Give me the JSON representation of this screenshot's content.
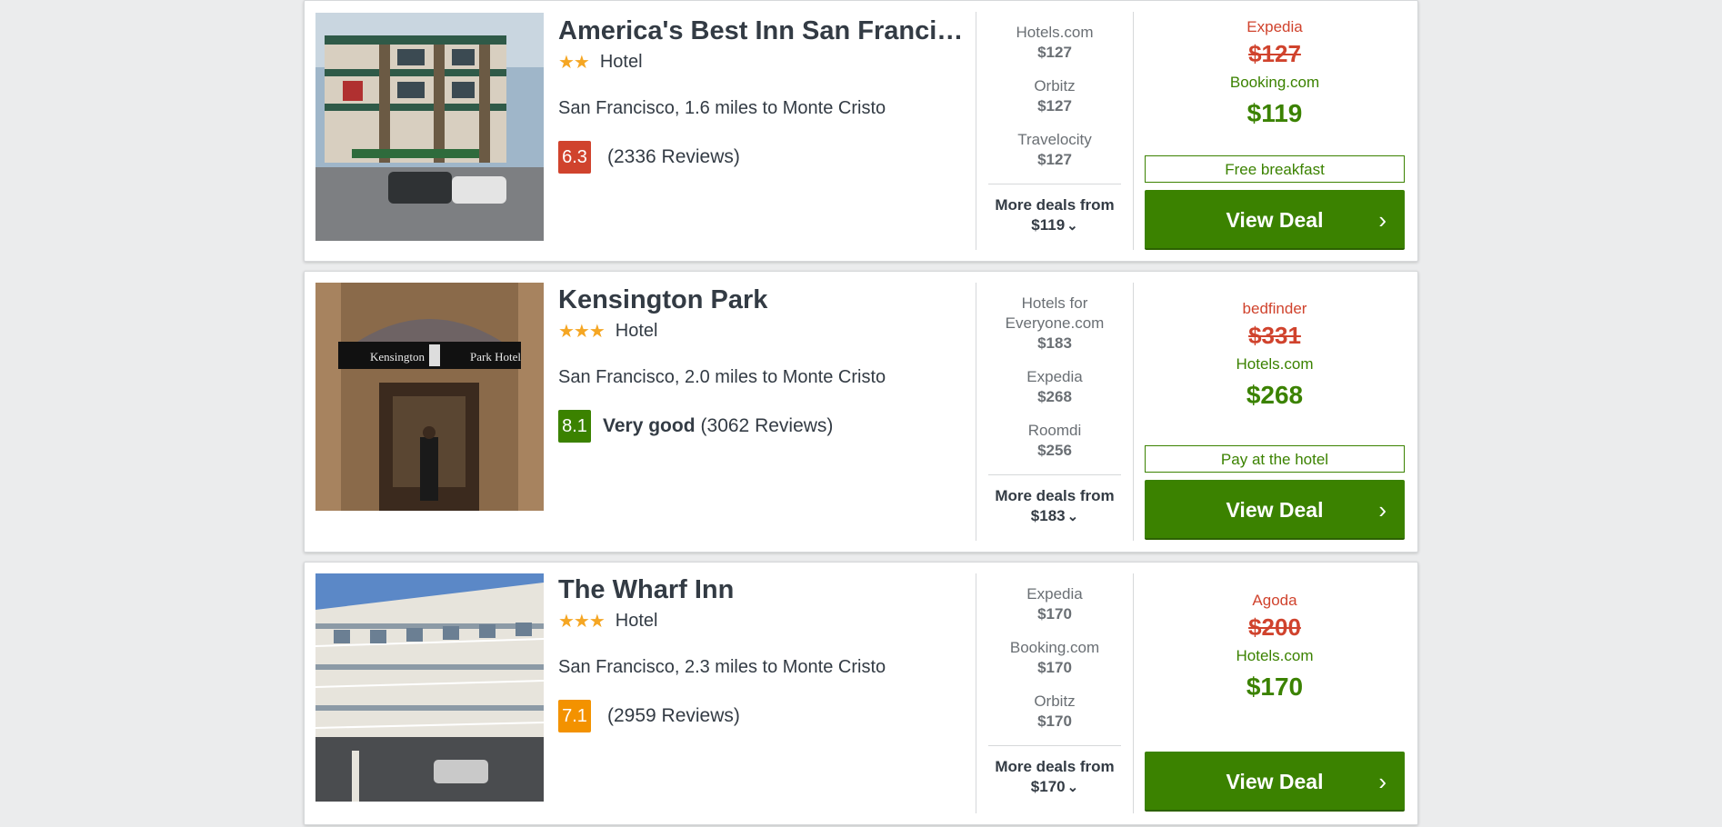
{
  "hotels": [
    {
      "name": "America's Best Inn San Francisco",
      "stars": "★★",
      "type": "Hotel",
      "location": "San Francisco, 1.6 miles to Monte Cristo",
      "score": "6.3",
      "score_color": "#d0432d",
      "rating_label": "",
      "reviews": "(2336 Reviews)",
      "deals": [
        {
          "provider": "Hotels.com",
          "price": "$127"
        },
        {
          "provider": "Orbitz",
          "price": "$127"
        },
        {
          "provider": "Travelocity",
          "price": "$127"
        }
      ],
      "more_label": "More deals from",
      "more_price": "$119",
      "old_provider": "Expedia",
      "old_price": "$127",
      "new_provider": "Booking.com",
      "new_price": "$119",
      "perk": "Free breakfast",
      "button": "View Deal"
    },
    {
      "name": "Kensington Park",
      "stars": "★★★",
      "type": "Hotel",
      "location": "San Francisco, 2.0 miles to Monte Cristo",
      "score": "8.1",
      "score_color": "#3b8200",
      "rating_label": "Very good",
      "reviews": "(3062 Reviews)",
      "deals": [
        {
          "provider": "Hotels for Everyone.com",
          "price": "$183"
        },
        {
          "provider": "Expedia",
          "price": "$268"
        },
        {
          "provider": "Roomdi",
          "price": "$256"
        }
      ],
      "more_label": "More deals from",
      "more_price": "$183",
      "old_provider": "bedfinder",
      "old_price": "$331",
      "new_provider": "Hotels.com",
      "new_price": "$268",
      "perk": "Pay at the hotel",
      "button": "View Deal"
    },
    {
      "name": "The Wharf Inn",
      "stars": "★★★",
      "type": "Hotel",
      "location": "San Francisco, 2.3 miles to Monte Cristo",
      "score": "7.1",
      "score_color": "#f39200",
      "rating_label": "",
      "reviews": "(2959 Reviews)",
      "deals": [
        {
          "provider": "Expedia",
          "price": "$170"
        },
        {
          "provider": "Booking.com",
          "price": "$170"
        },
        {
          "provider": "Orbitz",
          "price": "$170"
        }
      ],
      "more_label": "More deals from",
      "more_price": "$170",
      "old_provider": "Agoda",
      "old_price": "$200",
      "new_provider": "Hotels.com",
      "new_price": "$170",
      "perk": "",
      "button": "View Deal"
    }
  ]
}
